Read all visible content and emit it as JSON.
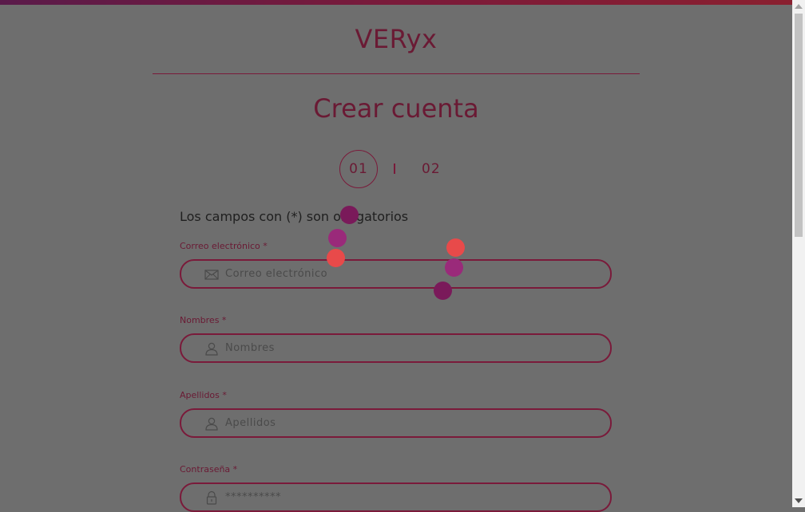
{
  "brand": {
    "logo_text": "VERyx"
  },
  "page": {
    "title": "Crear cuenta"
  },
  "steps": [
    {
      "label": "01",
      "active": true
    },
    {
      "label": "02",
      "active": false
    }
  ],
  "form": {
    "required_note": "Los campos con (*) son obligatorios",
    "fields": [
      {
        "label": "Correo electrónico *",
        "placeholder": "Correo electrónico",
        "icon": "envelope-icon"
      },
      {
        "label": "Nombres *",
        "placeholder": "Nombres",
        "icon": "user-icon"
      },
      {
        "label": "Apellidos *",
        "placeholder": "Apellidos",
        "icon": "user-icon"
      },
      {
        "label": "Contraseña *",
        "placeholder": "**********",
        "icon": "lock-icon"
      }
    ]
  },
  "colors": {
    "overlay": "#6e6e6e",
    "brand": "#7a1a3a",
    "dot_purple": "#7a1a5a",
    "dot_magenta": "#9a2a7a",
    "dot_coral": "#e84a4a"
  }
}
